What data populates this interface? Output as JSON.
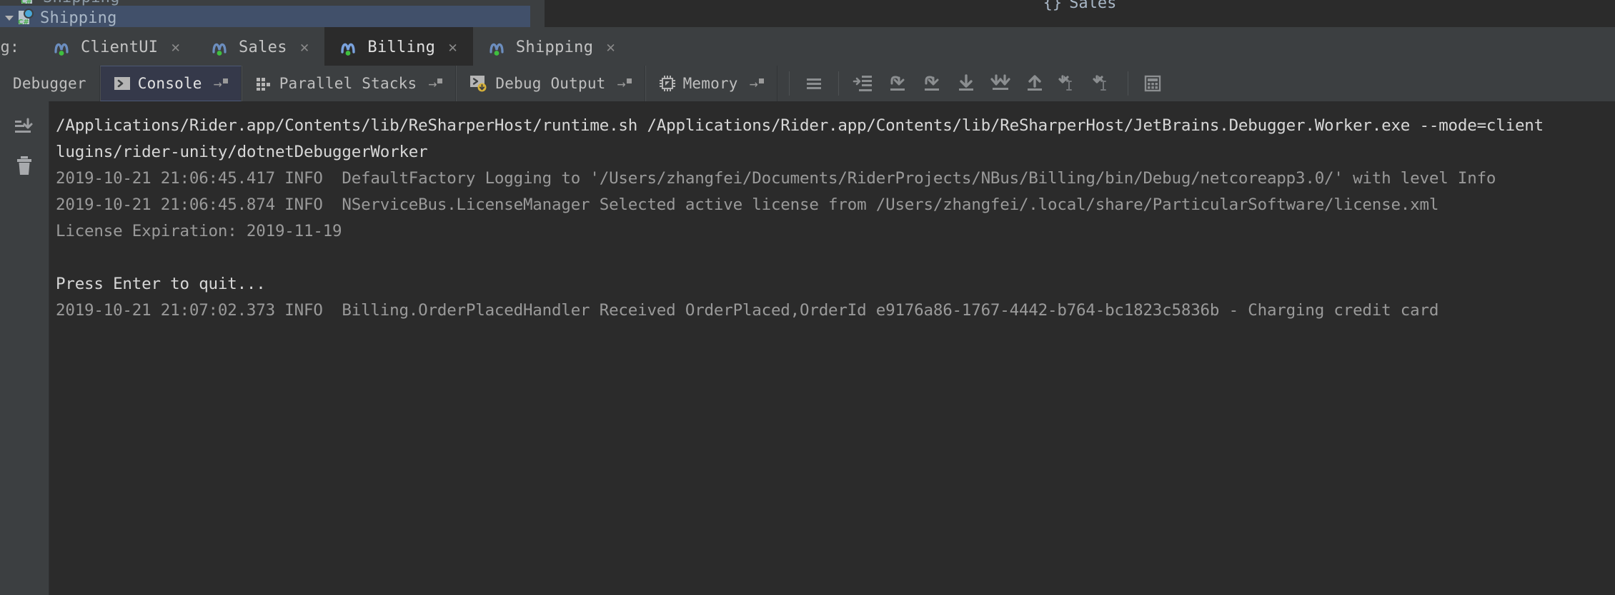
{
  "window": {
    "background": "#3c3f41",
    "console_background": "#2b2b2b",
    "accent": "#4d5875"
  },
  "tree": {
    "clipped_row_label": "Shipping",
    "selected_row_label": "Shipping",
    "toggle_icon": "triangle-down-icon",
    "project_icon": "csharp-project-icon"
  },
  "breadcrumb": {
    "open_brace": "{}",
    "label": "Sales"
  },
  "session": {
    "label": "bug:",
    "tabs": [
      {
        "label": "ClientUI",
        "icon": "nservicebus-icon",
        "close": "✕",
        "active": false,
        "running": true
      },
      {
        "label": "Sales",
        "icon": "nservicebus-icon",
        "close": "✕",
        "active": false,
        "running": true
      },
      {
        "label": "Billing",
        "icon": "nservicebus-icon",
        "close": "✕",
        "active": true,
        "running": true
      },
      {
        "label": "Shipping",
        "icon": "nservicebus-icon",
        "close": "✕",
        "active": false,
        "running": true
      }
    ]
  },
  "debug_toolbar": {
    "tabs": [
      {
        "label": "Debugger",
        "icon": null,
        "pin": false,
        "active": false
      },
      {
        "label": "Console",
        "icon": "console-icon",
        "pin": true,
        "active": true
      },
      {
        "label": "Parallel Stacks",
        "icon": "stacks-icon",
        "pin": true,
        "active": false
      },
      {
        "label": "Debug Output",
        "icon": "debug-output-icon",
        "pin": true,
        "active": false
      },
      {
        "label": "Memory",
        "icon": "memory-chip-icon",
        "pin": true,
        "active": false
      }
    ],
    "pin_glyph": "→",
    "buttons": [
      {
        "name": "soft-wrap-icon",
        "group": 0
      },
      {
        "name": "step-into-my-code-icon",
        "group": 1
      },
      {
        "name": "force-step-over-icon",
        "group": 1
      },
      {
        "name": "step-over-icon",
        "group": 1
      },
      {
        "name": "step-into-icon",
        "group": 1
      },
      {
        "name": "force-step-into-icon",
        "group": 1
      },
      {
        "name": "step-out-icon",
        "group": 1
      },
      {
        "name": "run-to-cursor-icon",
        "group": 1
      },
      {
        "name": "force-run-to-cursor-icon",
        "group": 1
      },
      {
        "name": "evaluate-expression-icon",
        "group": 2
      }
    ]
  },
  "console_gutter": {
    "buttons": [
      {
        "name": "scroll-to-end-icon"
      },
      {
        "name": "clear-all-icon"
      }
    ]
  },
  "console": {
    "lines": [
      {
        "text": "/Applications/Rider.app/Contents/lib/ReSharperHost/runtime.sh /Applications/Rider.app/Contents/lib/ReSharperHost/JetBrains.Debugger.Worker.exe --mode=client",
        "style": "white"
      },
      {
        "text": "lugins/rider-unity/dotnetDebuggerWorker",
        "style": "white"
      },
      {
        "text": "2019-10-21 21:06:45.417 INFO  DefaultFactory Logging to '/Users/zhangfei/Documents/RiderProjects/NBus/Billing/bin/Debug/netcoreapp3.0/' with level Info",
        "style": "gray"
      },
      {
        "text": "2019-10-21 21:06:45.874 INFO  NServiceBus.LicenseManager Selected active license from /Users/zhangfei/.local/share/ParticularSoftware/license.xml",
        "style": "gray"
      },
      {
        "text": "License Expiration: 2019-11-19",
        "style": "gray"
      },
      {
        "text": " ",
        "style": "blank"
      },
      {
        "text": "Press Enter to quit...",
        "style": "white"
      },
      {
        "text": "2019-10-21 21:07:02.373 INFO  Billing.OrderPlacedHandler Received OrderPlaced,OrderId e9176a86-1767-4442-b764-bc1823c5836b - Charging credit card",
        "style": "gray"
      }
    ]
  }
}
